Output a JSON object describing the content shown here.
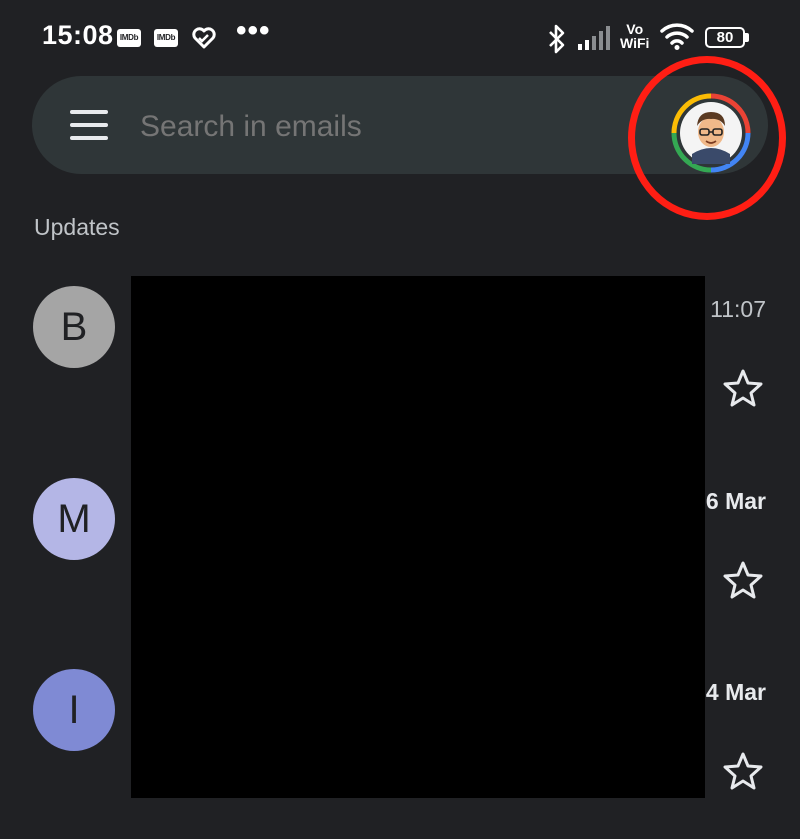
{
  "status_bar": {
    "time": "15:08",
    "notification_icons": [
      "IMDb",
      "IMDb"
    ],
    "imdb_label": "IMDb",
    "more": "•••",
    "vowifi_line1": "Vo",
    "vowifi_line2": "WiFi",
    "battery": "80"
  },
  "search": {
    "placeholder": "Search in emails"
  },
  "section": {
    "label": "Updates"
  },
  "emails": [
    {
      "initial": "B",
      "avatar_color": "#a5a5a5",
      "date": "11:07",
      "date_bold": false
    },
    {
      "initial": "M",
      "avatar_color": "#b4b6e6",
      "date": "6 Mar",
      "date_bold": true
    },
    {
      "initial": "I",
      "avatar_color": "#7f8ad4",
      "date": "4 Mar",
      "date_bold": true
    }
  ],
  "colors": {
    "background": "#202124",
    "search_bar": "#2f3638",
    "highlight": "#ff1e14"
  }
}
